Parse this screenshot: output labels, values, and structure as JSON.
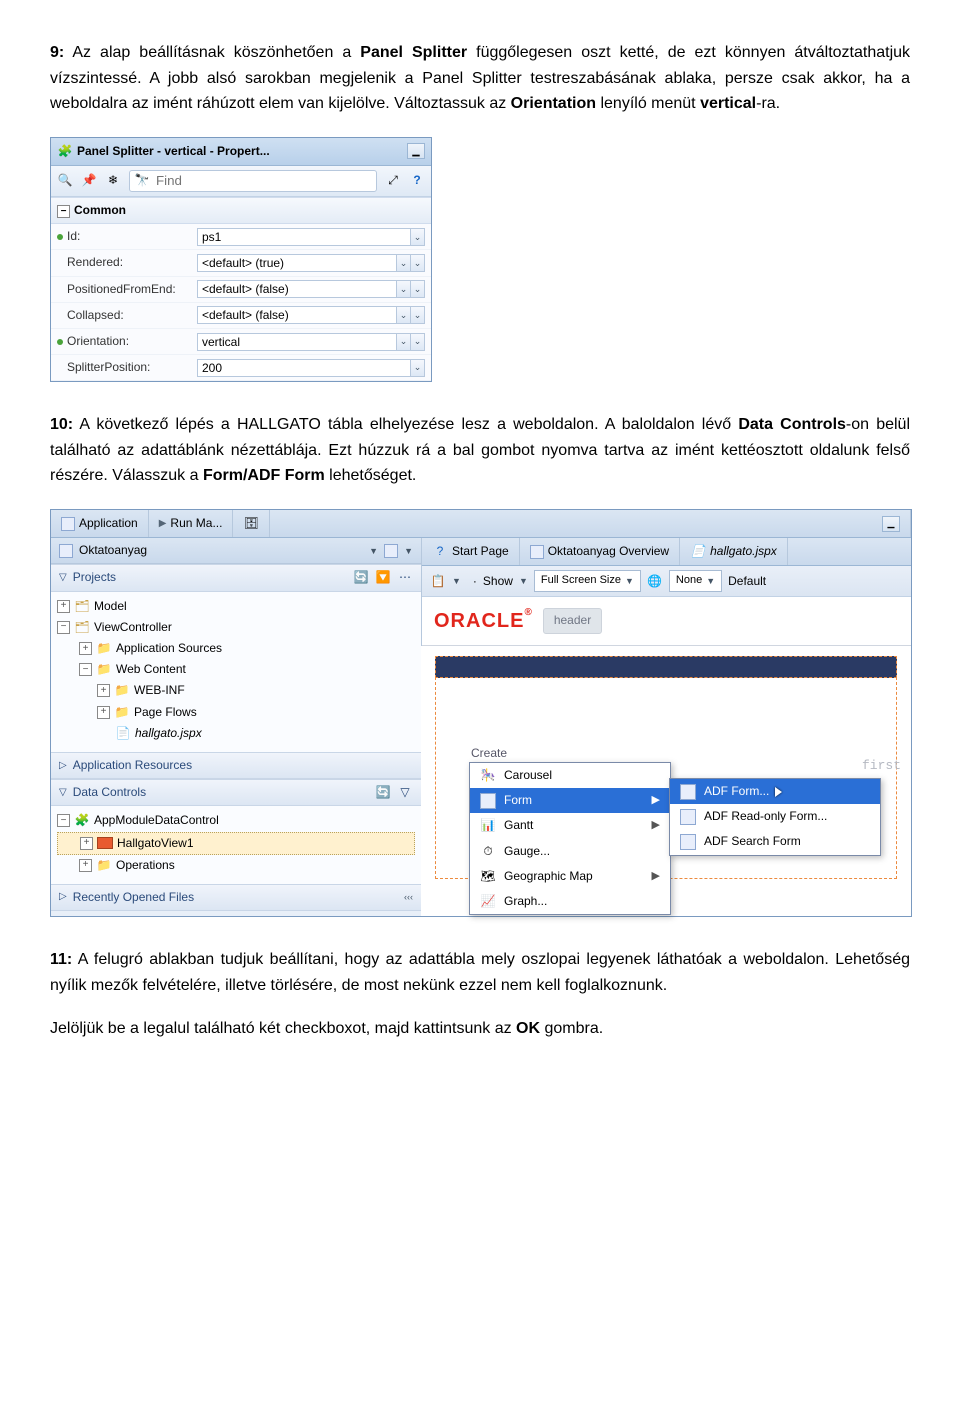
{
  "para1": {
    "lead": "9:",
    "t1": " Az alap beállításnak köszönhetően a ",
    "b1": "Panel Splitter",
    "t2": " függőlegesen oszt ketté, de ezt könnyen átváltoztathatjuk vízszintessé. A jobb alsó sarokban megjelenik a Panel Splitter testreszabásának ablaka, persze csak akkor, ha a weboldalra az imént ráhúzott elem van kijelölve. Változtassuk az ",
    "b2": "Orientation",
    "t3": " lenyíló menüt ",
    "b3": "vertical",
    "t4": "-ra."
  },
  "props": {
    "title": "Panel Splitter - vertical - Propert...",
    "find": "Find",
    "section": "Common",
    "rows": {
      "id_label": "Id:",
      "id_value": "ps1",
      "rendered_label": "Rendered:",
      "rendered_value": "<default> (true)",
      "pfe_label": "PositionedFromEnd:",
      "pfe_value": "<default> (false)",
      "collapsed_label": "Collapsed:",
      "collapsed_value": "<default> (false)",
      "orient_label": "Orientation:",
      "orient_value": "vertical",
      "split_label": "SplitterPosition:",
      "split_value": "200"
    }
  },
  "para2": {
    "lead": "10:",
    "t1": " A következő lépés a HALLGATO tábla elhelyezése lesz a weboldalon. A baloldalon lévő ",
    "b1": "Data Controls",
    "t2": "-on belül található az adattáblánk nézettáblája. Ezt húzzuk rá a bal gombot nyomva tartva az imént kettéosztott oldalunk felső részére. Válasszuk a ",
    "b2": "Form/ADF Form",
    "t3": " lehetőséget."
  },
  "ide": {
    "app_tab": "Application",
    "run_tab": "Run Ma...",
    "sel_app": "Oktatoanyag",
    "projects": "Projects",
    "tree": {
      "model": "Model",
      "vc": "ViewController",
      "appsrc": "Application Sources",
      "webc": "Web Content",
      "webinf": "WEB-INF",
      "pageflows": "Page Flows",
      "hallgato": "hallgato.jspx"
    },
    "app_res": "Application Resources",
    "data_controls": "Data Controls",
    "dc_root": "AppModuleDataControl",
    "dc_view": "HallgatoView1",
    "dc_ops": "Operations",
    "recent": "Recently Opened Files",
    "right_tabs": {
      "start": "Start Page",
      "overview": "Oktatoanyag Overview",
      "hallgato": "hallgato.jspx"
    },
    "toolbar": {
      "show": "Show",
      "fss": "Full Screen Size",
      "none": "None",
      "default": "Default"
    },
    "header_pill": "header",
    "ghost_create": "Create",
    "ghost_first": "first",
    "ctx": {
      "carousel": "Carousel",
      "form": "Form",
      "gantt": "Gantt",
      "gauge": "Gauge...",
      "geomap": "Geographic Map",
      "graph": "Graph..."
    },
    "sub": {
      "adfform": "ADF Form...",
      "readonly": "ADF Read-only Form...",
      "search": "ADF Search Form"
    }
  },
  "para3": {
    "lead": "11:",
    "t1": " A felugró ablakban tudjuk beállítani, hogy az adattábla mely oszlopai legyenek láthatóak a weboldalon. Lehetőség nyílik mezők felvételére, illetve törlésére, de most nekünk ezzel nem kell foglalkoznunk."
  },
  "para4": {
    "t1": "Jelöljük be a legalul található két checkboxot, majd kattintsunk az ",
    "b1": "OK",
    "t2": " gombra."
  }
}
